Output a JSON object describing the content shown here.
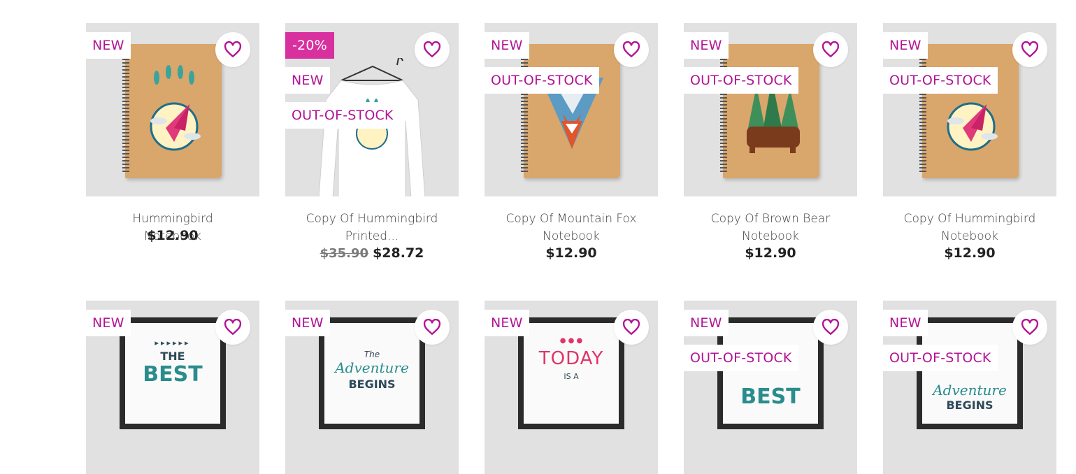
{
  "colors": {
    "accent": "#b21395",
    "discount_bg": "#d9309f",
    "thumb_bg": "#e1e1e1"
  },
  "wishlist_icon": "heart-outline-icon",
  "row1": [
    {
      "badges": [
        "NEW"
      ],
      "name": "Hummingbird Notebook",
      "price": "$12.90",
      "old_price": "",
      "art": "notebook-hummingbird"
    },
    {
      "discount": "-20%",
      "badges": [
        "NEW",
        "OUT-OF-STOCK"
      ],
      "name": "Copy Of Hummingbird Printed...",
      "price": "$28.72",
      "old_price": "$35.90",
      "art": "tshirt-hummingbird"
    },
    {
      "badges": [
        "NEW",
        "OUT-OF-STOCK"
      ],
      "name": "Copy Of Mountain Fox Notebook",
      "price": "$12.90",
      "old_price": "",
      "art": "notebook-fox"
    },
    {
      "badges": [
        "NEW",
        "OUT-OF-STOCK"
      ],
      "name": "Copy Of Brown Bear Notebook",
      "price": "$12.90",
      "old_price": "",
      "art": "notebook-bear"
    },
    {
      "badges": [
        "NEW",
        "OUT-OF-STOCK"
      ],
      "name": "Copy Of Hummingbird Notebook",
      "price": "$12.90",
      "old_price": "",
      "art": "notebook-hummingbird"
    }
  ],
  "row2": [
    {
      "badges": [
        "NEW"
      ],
      "art": "poster-best",
      "poster_text": [
        "THE",
        "BEST"
      ]
    },
    {
      "badges": [
        "NEW"
      ],
      "art": "poster-adventure",
      "poster_text": [
        "The",
        "Adventure",
        "BEGINS"
      ]
    },
    {
      "badges": [
        "NEW"
      ],
      "art": "poster-today",
      "poster_text": [
        "TODAY",
        "IS A"
      ]
    },
    {
      "badges": [
        "NEW",
        "OUT-OF-STOCK"
      ],
      "art": "poster-best",
      "poster_text": [
        "BEST"
      ]
    },
    {
      "badges": [
        "NEW",
        "OUT-OF-STOCK"
      ],
      "art": "poster-adventure",
      "poster_text": [
        "Adventure",
        "BEGINS"
      ]
    }
  ]
}
